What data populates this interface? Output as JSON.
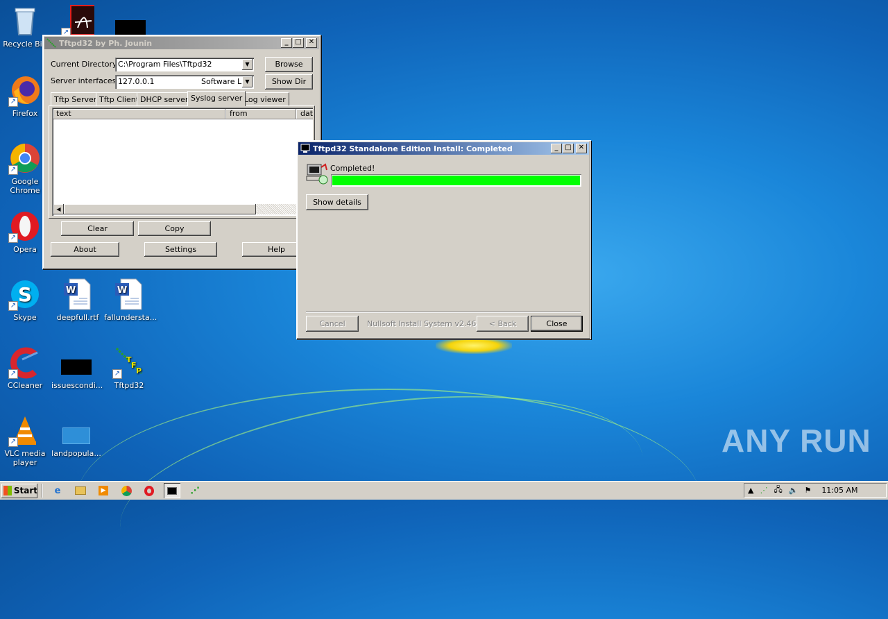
{
  "desktop": {
    "icons": [
      {
        "label": "Recycle Bin"
      },
      {
        "label": "Firefox"
      },
      {
        "label": "Google Chrome"
      },
      {
        "label": "Opera"
      },
      {
        "label": "Skype"
      },
      {
        "label": "deepfull.rtf"
      },
      {
        "label": "fallundersta..."
      },
      {
        "label": "CCleaner"
      },
      {
        "label": "issuescondi..."
      },
      {
        "label": "Tftpd32"
      },
      {
        "label": "VLC media player"
      },
      {
        "label": "landpopula..."
      }
    ],
    "watermark": "ANY RUN"
  },
  "tftpd_window": {
    "title": "Tftpd32 by Ph. Jounin",
    "current_directory_label": "Current Directory",
    "current_directory_value": "C:\\Program Files\\Tftpd32",
    "server_interfaces_label": "Server interfaces",
    "server_interfaces_value": "127.0.0.1",
    "server_interfaces_suffix": "Software L",
    "browse_button": "Browse",
    "show_dir_button": "Show Dir",
    "tabs": [
      "Tftp Server",
      "Tftp Client",
      "DHCP server",
      "Syslog server",
      "Log viewer"
    ],
    "selected_tab": "Syslog server",
    "columns": [
      "text",
      "from",
      "dat"
    ],
    "clear_button": "Clear",
    "copy_button": "Copy",
    "about_button": "About",
    "settings_button": "Settings",
    "help_button": "Help"
  },
  "installer_window": {
    "title": "Tftpd32 Standalone Edition Install: Completed",
    "status_text": "Completed!",
    "progress_fraction": 1.0,
    "progress_color": "#00ff00",
    "show_details_button": "Show details",
    "cancel_button": "Cancel",
    "branding": "Nullsoft Install System v2.46",
    "back_button": "< Back",
    "close_button": "Close"
  },
  "taskbar": {
    "start_label": "Start",
    "clock": "11:05 AM"
  }
}
